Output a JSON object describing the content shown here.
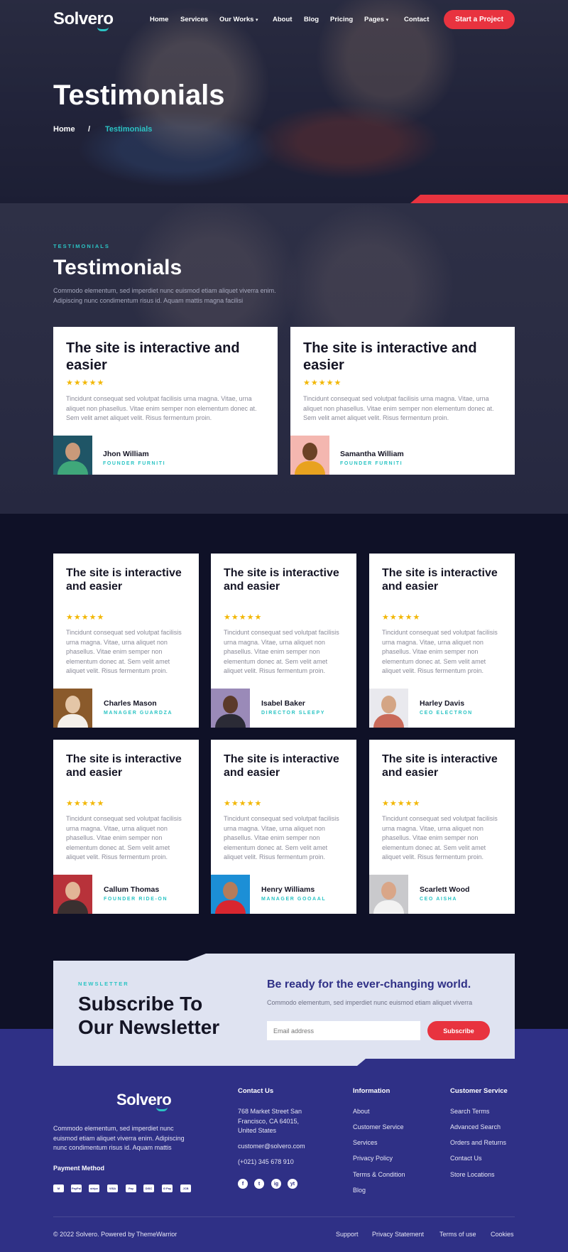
{
  "brand": {
    "name": "Solvero"
  },
  "nav": {
    "items": [
      "Home",
      "Services",
      "Our Works",
      "About",
      "Blog",
      "Pricing",
      "Pages",
      "Contact"
    ],
    "cta": "Start a Project"
  },
  "hero": {
    "title": "Testimonials",
    "breadcrumb_home": "Home",
    "breadcrumb_sep": "/",
    "breadcrumb_current": "Testimonials"
  },
  "featured": {
    "eyebrow": "TESTIMONIALS",
    "title": "Testimonials",
    "subtitle_line1": "Commodo elementum, sed imperdiet nunc euismod etiam aliquet viverra enim.",
    "subtitle_line2": "Adipiscing nunc condimentum risus id. Aquam mattis magna facilisi"
  },
  "testimonials": [
    {
      "title": "The site is interactive and easier",
      "stars": "★★★★★",
      "body": "Tincidunt consequat sed volutpat facilisis urna magna. Vitae, urna aliquet non phasellus. Vitae enim semper non elementum donec at. Sem velit amet aliquet velit. Risus fermentum proin.",
      "name": "Jhon William",
      "role": "FOUNDER FURNITI"
    },
    {
      "title": "The site is interactive and easier",
      "stars": "★★★★★",
      "body": "Tincidunt consequat sed volutpat facilisis urna magna. Vitae, urna aliquet non phasellus. Vitae enim semper non elementum donec at. Sem velit amet aliquet velit. Risus fermentum proin.",
      "name": "Samantha William",
      "role": "FOUNDER FURNITI"
    },
    {
      "title": "The site is interactive and easier",
      "stars": "★★★★★",
      "body": "Tincidunt consequat sed volutpat facilisis urna magna. Vitae, urna aliquet non phasellus. Vitae enim semper non elementum donec at. Sem velit amet aliquet velit. Risus fermentum proin.",
      "name": "Charles Mason",
      "role": "MANAGER GUARDZA"
    },
    {
      "title": "The site is interactive and easier",
      "stars": "★★★★★",
      "body": "Tincidunt consequat sed volutpat facilisis urna magna. Vitae, urna aliquet non phasellus. Vitae enim semper non elementum donec at. Sem velit amet aliquet velit. Risus fermentum proin.",
      "name": "Isabel Baker",
      "role": "DIRECTOR SLEEPY"
    },
    {
      "title": "The site is interactive and easier",
      "stars": "★★★★★",
      "body": "Tincidunt consequat sed volutpat facilisis urna magna. Vitae, urna aliquet non phasellus. Vitae enim semper non elementum donec at. Sem velit amet aliquet velit. Risus fermentum proin.",
      "name": "Harley Davis",
      "role": "CEO ELECTRON"
    },
    {
      "title": "The site is interactive and easier",
      "stars": "★★★★★",
      "body": "Tincidunt consequat sed volutpat facilisis urna magna. Vitae, urna aliquet non phasellus. Vitae enim semper non elementum donec at. Sem velit amet aliquet velit. Risus fermentum proin.",
      "name": "Callum Thomas",
      "role": "FOUNDER RIDE-ON"
    },
    {
      "title": "The site is interactive and easier",
      "stars": "★★★★★",
      "body": "Tincidunt consequat sed volutpat facilisis urna magna. Vitae, urna aliquet non phasellus. Vitae enim semper non elementum donec at. Sem velit amet aliquet velit. Risus fermentum proin.",
      "name": "Henry Williams",
      "role": "MANAGER GOOAAL"
    },
    {
      "title": "The site is interactive and easier",
      "stars": "★★★★★",
      "body": "Tincidunt consequat sed volutpat facilisis urna magna. Vitae, urna aliquet non phasellus. Vitae enim semper non elementum donec at. Sem velit amet aliquet velit. Risus fermentum proin.",
      "name": "Scarlett Wood",
      "role": "CEO AISHA"
    }
  ],
  "newsletter": {
    "eyebrow": "NEWSLETTER",
    "title_line1": "Subscribe To",
    "title_line2": "Our Newsletter",
    "heading": "Be ready for the ever-changing world.",
    "subtitle": "Commodo elementum, sed imperdiet nunc euismod etiam aliquet viverra",
    "placeholder": "Email address",
    "button": "Subscribe"
  },
  "footer": {
    "about": "Commodo elementum, sed imperdiet nunc euismod etiam aliquet viverra enim. Adipiscing nunc condimentum risus id. Aquam mattis",
    "payment_title": "Payment Method",
    "payment_methods": [
      "M",
      "PayPal",
      "stripe",
      "VISA",
      "Pay",
      "DISC",
      "G Pay",
      "JCB"
    ],
    "contact_title": "Contact Us",
    "address": "768 Market Street San Francisco, CA 64015, United States",
    "email": "customer@solvero.com",
    "phone": "(+021) 345 678 910",
    "social": [
      "f",
      "t",
      "ig",
      "yt"
    ],
    "info_title": "Information",
    "info_links": [
      "About",
      "Customer Service",
      "Services",
      "Privacy Policy",
      "Terms & Condition",
      "Blog"
    ],
    "service_title": "Customer Service",
    "service_links": [
      "Search Terms",
      "Advanced Search",
      "Orders and Returns",
      "Contact Us",
      "Store Locations"
    ],
    "copyright": "© 2022 Solvero. Powered by ThemeWarrior",
    "bottom_links": [
      "Support",
      "Privacy Statement",
      "Terms of use",
      "Cookies"
    ]
  },
  "colors": {
    "accent": "#e8333f",
    "teal": "#2bc4c4",
    "navy": "#2f3086",
    "dark": "#0f1127"
  }
}
